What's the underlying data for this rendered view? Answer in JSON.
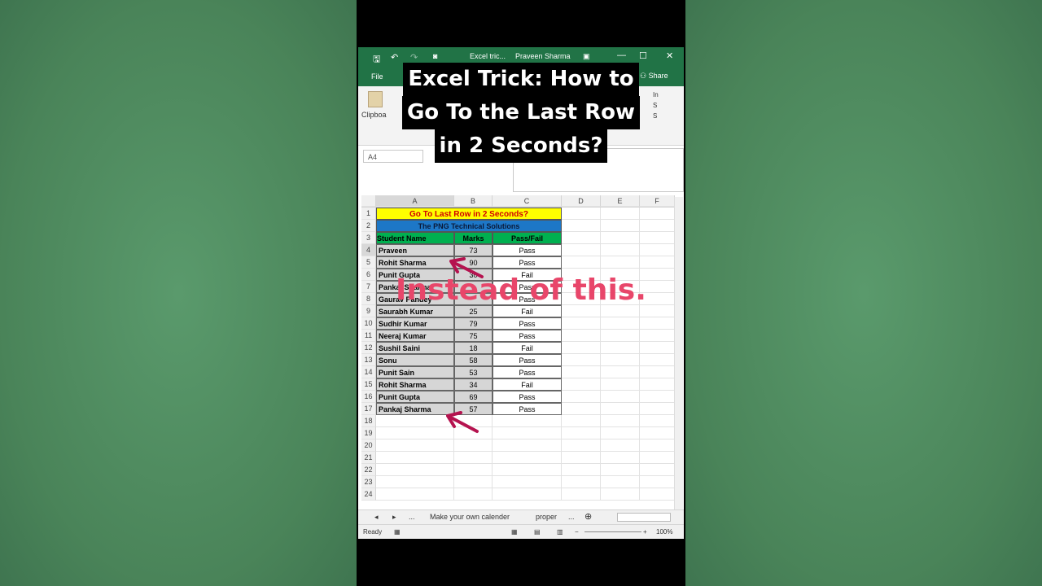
{
  "window": {
    "doc_title": "Excel tric...",
    "user": "Praveen Sharma",
    "file_tab": "File",
    "share": "Share",
    "clipboard": "Clipboa",
    "ribbon_right": [
      "In",
      "S",
      "S"
    ]
  },
  "name_box": "A4",
  "caption_lines": [
    "Excel Trick: How to",
    "Go To the Last Row",
    "in 2 Seconds?"
  ],
  "overlay_text": "Instead of this.",
  "columns": [
    "A",
    "B",
    "C",
    "D",
    "E",
    "F"
  ],
  "sheet": {
    "title": "Go To Last Row in 2 Seconds?",
    "subtitle": "The PNG Technical Solutions",
    "headers": [
      "Student Name",
      "Marks",
      "Pass/Fail"
    ],
    "rows": [
      [
        "Praveen",
        "73",
        "Pass"
      ],
      [
        "Rohit Sharma",
        "90",
        "Pass"
      ],
      [
        "Punit Gupta",
        "30",
        "Fail"
      ],
      [
        "Pankaj Sharma",
        "",
        "Pass"
      ],
      [
        "Gaurav Pandey",
        "",
        "Pass"
      ],
      [
        "Saurabh Kumar",
        "25",
        "Fail"
      ],
      [
        "Sudhir Kumar",
        "79",
        "Pass"
      ],
      [
        "Neeraj Kumar",
        "75",
        "Pass"
      ],
      [
        "Sushil Saini",
        "18",
        "Fail"
      ],
      [
        "Sonu",
        "58",
        "Pass"
      ],
      [
        "Punit Sain",
        "53",
        "Pass"
      ],
      [
        "Rohit Sharma",
        "34",
        "Fail"
      ],
      [
        "Punit Gupta",
        "69",
        "Pass"
      ],
      [
        "Pankaj Sharma",
        "57",
        "Pass"
      ]
    ],
    "row_numbers": [
      "1",
      "2",
      "3",
      "4",
      "5",
      "6",
      "7",
      "8",
      "9",
      "10",
      "11",
      "12",
      "13",
      "14",
      "15",
      "16",
      "17",
      "18",
      "19",
      "20",
      "21",
      "22",
      "23",
      "24"
    ]
  },
  "sheet_tabs": {
    "ellipsis": "...",
    "tab1": "Make your own calender",
    "tab2": "proper",
    "more": "..."
  },
  "status": {
    "ready": "Ready",
    "zoom": "100%"
  },
  "colors": {
    "excel_green": "#217346",
    "title_yellow": "#ffff00",
    "subtitle_blue": "#1d77c7",
    "header_green": "#00b050",
    "overlay_pink": "#e8466a",
    "arrow": "#b5134f"
  }
}
